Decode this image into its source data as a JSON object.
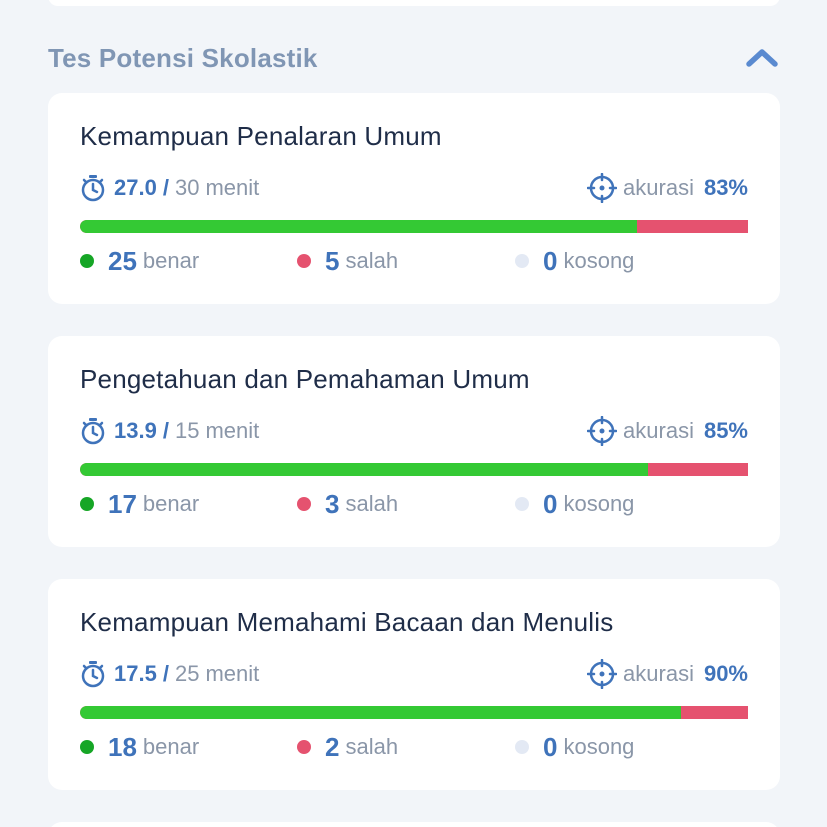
{
  "section": {
    "title": "Tes Potensi Skolastik",
    "collapse_icon": "chevron-up-icon"
  },
  "colors": {
    "accent": "#3f73ba",
    "correct": "#34c934",
    "wrong": "#e5526f",
    "empty": "#e3e9f4"
  },
  "cards": [
    {
      "title": "Kemampuan Penalaran Umum",
      "time_used": "27.0",
      "time_slash": "/",
      "time_total": "30",
      "time_unit": "menit",
      "accuracy_label": "akurasi",
      "accuracy_value": "83%",
      "correct": "25",
      "correct_label": "benar",
      "wrong": "5",
      "wrong_label": "salah",
      "empty": "0",
      "empty_label": "kosong",
      "correct_fraction": 0.834
    },
    {
      "title": "Pengetahuan dan Pemahaman Umum",
      "time_used": "13.9",
      "time_slash": "/",
      "time_total": "15",
      "time_unit": "menit",
      "accuracy_label": "akurasi",
      "accuracy_value": "85%",
      "correct": "17",
      "correct_label": "benar",
      "wrong": "3",
      "wrong_label": "salah",
      "empty": "0",
      "empty_label": "kosong",
      "correct_fraction": 0.85
    },
    {
      "title": "Kemampuan Memahami Bacaan dan Menulis",
      "time_used": "17.5",
      "time_slash": "/",
      "time_total": "25",
      "time_unit": "menit",
      "accuracy_label": "akurasi",
      "accuracy_value": "90%",
      "correct": "18",
      "correct_label": "benar",
      "wrong": "2",
      "wrong_label": "salah",
      "empty": "0",
      "empty_label": "kosong",
      "correct_fraction": 0.9
    }
  ]
}
